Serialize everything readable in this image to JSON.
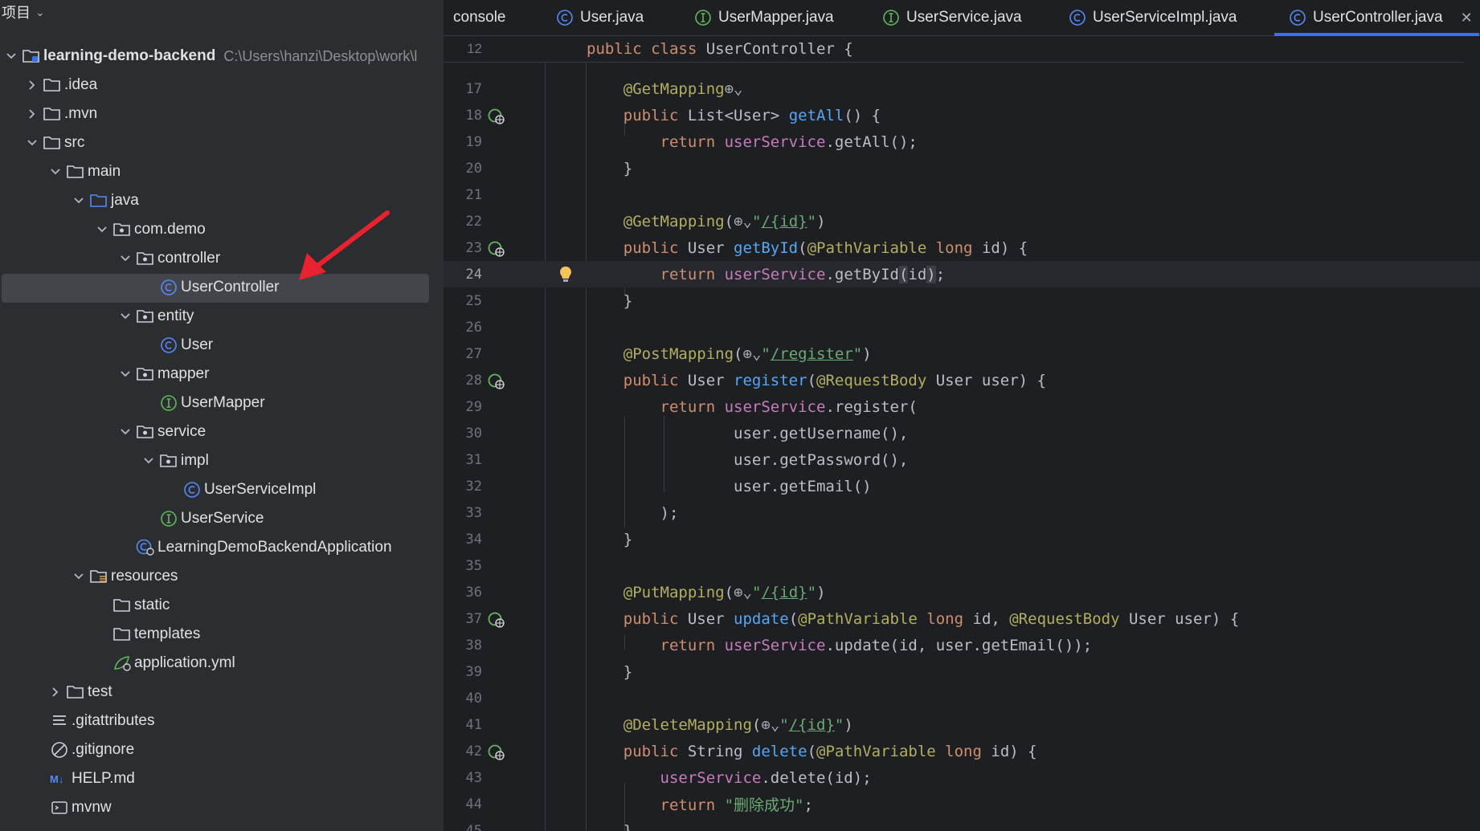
{
  "project_panel": {
    "title": "项目",
    "root": {
      "name": "learning-demo-backend",
      "path": "C:\\Users\\hanzi\\Desktop\\work\\l"
    },
    "items": [
      {
        "label": ".idea"
      },
      {
        "label": ".mvn"
      },
      {
        "label": "src"
      },
      {
        "label": "main"
      },
      {
        "label": "java"
      },
      {
        "label": "com.demo"
      },
      {
        "label": "controller"
      },
      {
        "label": "UserController"
      },
      {
        "label": "entity"
      },
      {
        "label": "User"
      },
      {
        "label": "mapper"
      },
      {
        "label": "UserMapper"
      },
      {
        "label": "service"
      },
      {
        "label": "impl"
      },
      {
        "label": "UserServiceImpl"
      },
      {
        "label": "UserService"
      },
      {
        "label": "LearningDemoBackendApplication"
      },
      {
        "label": "resources"
      },
      {
        "label": "static"
      },
      {
        "label": "templates"
      },
      {
        "label": "application.yml"
      },
      {
        "label": "test"
      },
      {
        "label": ".gitattributes"
      },
      {
        "label": ".gitignore"
      },
      {
        "label": "HELP.md"
      },
      {
        "label": "mvnw"
      }
    ]
  },
  "tabs": [
    {
      "label": "console"
    },
    {
      "label": "User.java"
    },
    {
      "label": "UserMapper.java"
    },
    {
      "label": "UserService.java"
    },
    {
      "label": "UserServiceImpl.java"
    },
    {
      "label": "UserController.java"
    }
  ],
  "sticky_line": {
    "number": "12",
    "text": "public class UserController {"
  },
  "code_lines": [
    {
      "n": "17",
      "t": "    @GetMapping⊕"
    },
    {
      "n": "18",
      "t": "    public List<User> getAll() {"
    },
    {
      "n": "19",
      "t": "        return userService.getAll();"
    },
    {
      "n": "20",
      "t": "    }"
    },
    {
      "n": "21",
      "t": ""
    },
    {
      "n": "22",
      "t": "    @GetMapping(⊕\"/{id}\")"
    },
    {
      "n": "23",
      "t": "    public User getById(@PathVariable long id) {"
    },
    {
      "n": "24",
      "t": "        return userService.getById(id);"
    },
    {
      "n": "25",
      "t": "    }"
    },
    {
      "n": "26",
      "t": ""
    },
    {
      "n": "27",
      "t": "    @PostMapping(⊕\"/register\")"
    },
    {
      "n": "28",
      "t": "    public User register(@RequestBody User user) {"
    },
    {
      "n": "29",
      "t": "        return userService.register("
    },
    {
      "n": "30",
      "t": "                user.getUsername(),"
    },
    {
      "n": "31",
      "t": "                user.getPassword(),"
    },
    {
      "n": "32",
      "t": "                user.getEmail()"
    },
    {
      "n": "33",
      "t": "        );"
    },
    {
      "n": "34",
      "t": "    }"
    },
    {
      "n": "35",
      "t": ""
    },
    {
      "n": "36",
      "t": "    @PutMapping(⊕\"/{id}\")"
    },
    {
      "n": "37",
      "t": "    public User update(@PathVariable long id, @RequestBody User user) {"
    },
    {
      "n": "38",
      "t": "        return userService.update(id, user.getEmail());"
    },
    {
      "n": "39",
      "t": "    }"
    },
    {
      "n": "40",
      "t": ""
    },
    {
      "n": "41",
      "t": "    @DeleteMapping(⊕\"/{id}\")"
    },
    {
      "n": "42",
      "t": "    public String delete(@PathVariable long id) {"
    },
    {
      "n": "43",
      "t": "        userService.delete(id);"
    },
    {
      "n": "44",
      "t": "        return \"删除成功\";"
    },
    {
      "n": "45",
      "t": "    }"
    }
  ],
  "colors": {
    "accent": "#3574f0",
    "keyword": "#cf8e6d",
    "annotation": "#b3ae60",
    "function": "#56a8f5",
    "field": "#c77dbb",
    "string": "#6aab73",
    "class_icon": "#548af7",
    "interface_icon": "#5fb85b",
    "arrow": "#e8222e"
  }
}
